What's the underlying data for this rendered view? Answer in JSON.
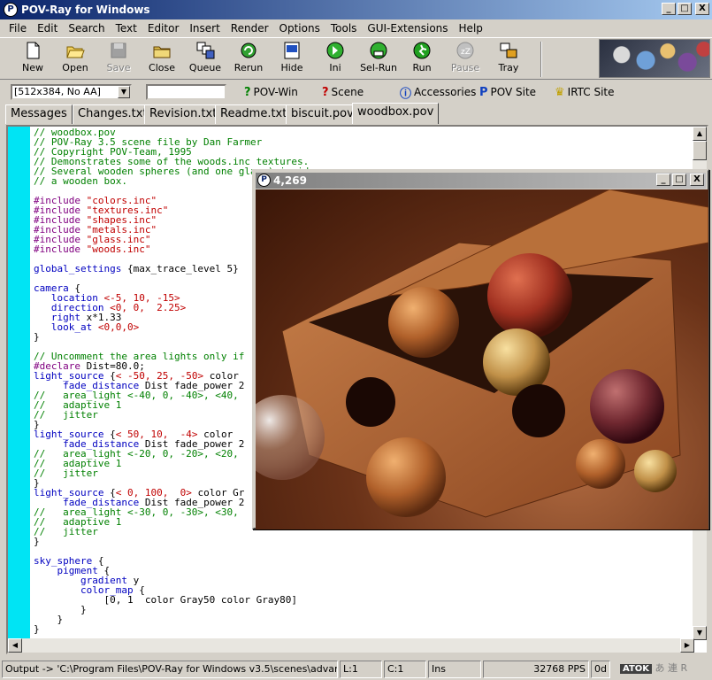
{
  "window": {
    "title": "POV-Ray for Windows",
    "buttons": [
      "_",
      "□",
      "X"
    ]
  },
  "menu": [
    "File",
    "Edit",
    "Search",
    "Text",
    "Editor",
    "Insert",
    "Render",
    "Options",
    "Tools",
    "GUI-Extensions",
    "Help"
  ],
  "toolbar": {
    "buttons": [
      {
        "label": "New",
        "icon": "new-file-icon",
        "enabled": true
      },
      {
        "label": "Open",
        "icon": "open-folder-icon",
        "enabled": true
      },
      {
        "label": "Save",
        "icon": "save-disk-icon",
        "enabled": false
      },
      {
        "label": "Close",
        "icon": "close-folder-icon",
        "enabled": true
      },
      {
        "label": "Queue",
        "icon": "queue-icon",
        "enabled": true
      },
      {
        "label": "Rerun",
        "icon": "rerun-icon",
        "enabled": true
      },
      {
        "label": "Hide",
        "icon": "hide-icon",
        "enabled": true
      },
      {
        "label": "Ini",
        "icon": "ini-runner-icon",
        "enabled": true
      },
      {
        "label": "Sel-Run",
        "icon": "sel-run-icon",
        "enabled": true
      },
      {
        "label": "Run",
        "icon": "run-icon",
        "enabled": true
      },
      {
        "label": "Pause",
        "icon": "pause-icon",
        "enabled": false
      },
      {
        "label": "Tray",
        "icon": "tray-icon",
        "enabled": true
      }
    ]
  },
  "toolbar2": {
    "resolution": "[512x384, No AA]",
    "command_value": "",
    "links": [
      {
        "label": "POV-Win",
        "icon": "help-icon"
      },
      {
        "label": "Scene",
        "icon": "help-icon"
      },
      {
        "label": "Accessories",
        "icon": "info-icon"
      },
      {
        "label": "POV Site",
        "icon": "pov-site-icon"
      },
      {
        "label": "IRTC Site",
        "icon": "trophy-icon"
      }
    ]
  },
  "tabs": [
    {
      "label": "Messages",
      "active": false
    },
    {
      "label": "Changes.txt",
      "active": false
    },
    {
      "label": "Revision.txt",
      "active": false
    },
    {
      "label": "Readme.txt",
      "active": false
    },
    {
      "label": "biscuit.pov",
      "active": false
    },
    {
      "label": "woodbox.pov",
      "active": true
    }
  ],
  "code_lines": [
    "// woodbox.pov",
    "// POV-Ray 3.5 scene file by Dan Farmer",
    "// Copyright POV-Team, 1995",
    "// Demonstrates some of the woods.inc textures.",
    "// Several wooden spheres (and one glass) inside",
    "// a wooden box.",
    "",
    "#include \"colors.inc\"",
    "#include \"textures.inc\"",
    "#include \"shapes.inc\"",
    "#include \"metals.inc\"",
    "#include \"glass.inc\"",
    "#include \"woods.inc\"",
    "",
    "global_settings {max_trace_level 5}",
    "",
    "camera {",
    "   location <-5, 10, -15>",
    "   direction <0, 0,  2.25>",
    "   right x*1.33",
    "   look_at <0,0,0>",
    "}",
    "",
    "// Uncomment the area lights only if",
    "#declare Dist=80.0;",
    "light_source {< -50, 25, -50> color",
    "     fade_distance Dist fade_power 2",
    "//   area_light <-40, 0, -40>, <40,",
    "//   adaptive 1",
    "//   jitter",
    "}",
    "light_source {< 50, 10,  -4> color",
    "     fade_distance Dist fade_power 2",
    "//   area_light <-20, 0, -20>, <20,",
    "//   adaptive 1",
    "//   jitter",
    "}",
    "light_source {< 0, 100,  0> color Gr",
    "     fade_distance Dist fade_power 2",
    "//   area_light <-30, 0, -30>, <30,",
    "//   adaptive 1",
    "//   jitter",
    "}",
    "",
    "sky_sphere {",
    "    pigment {",
    "        gradient y",
    "        color_map {",
    "            [0, 1  color Gray50 color Gray80]",
    "        }",
    "    }",
    "}"
  ],
  "render_window": {
    "title": "4,269",
    "buttons": [
      "_",
      "□",
      "X"
    ]
  },
  "status": {
    "output": "Output -> 'C:\\Program Files\\POV-Ray for Windows v3.5\\scenes\\advar",
    "line": "L:1",
    "col": "C:1",
    "mode": "Ins",
    "pps": "32768 PPS",
    "time": "0d",
    "ime": "ATOK",
    "ime_chars": "あ 連 R"
  },
  "colors": {
    "title_active": "#0a246a",
    "title_inactive": "#808080",
    "gutter": "#00e4f4",
    "comment": "#008000",
    "string": "#c00000",
    "directive": "#800080"
  }
}
